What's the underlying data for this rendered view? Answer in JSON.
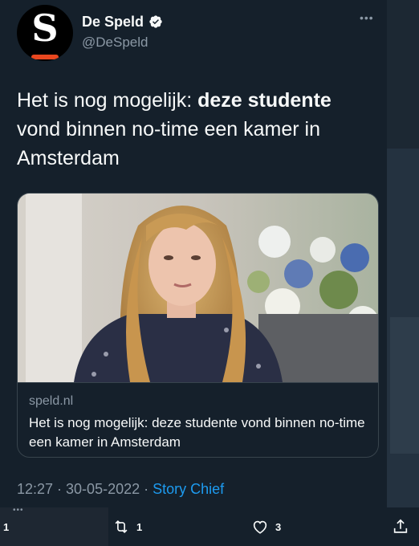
{
  "account": {
    "name": "De Speld",
    "handle": "@DeSpeld",
    "avatar_letter": "S",
    "verified": true
  },
  "tweet": {
    "text_prefix": "Het is nog mogelijk: ",
    "text_bold": "deze studente",
    "text_suffix": " vond binnen no-time een kamer in Amsterdam",
    "timestamp": "12:27 · 30-05-2022 · ",
    "source": "Story Chief"
  },
  "card": {
    "domain": "speld.nl",
    "title": "Het is nog mogelijk: deze studente vond binnen no-time een kamer in Amsterdam"
  },
  "actions": {
    "left_count": "1",
    "retweets": "1",
    "likes": "3"
  },
  "colors": {
    "background": "#15202b",
    "accent": "#1d9bf0",
    "muted": "#8b98a5",
    "text": "#f7f9f9"
  }
}
